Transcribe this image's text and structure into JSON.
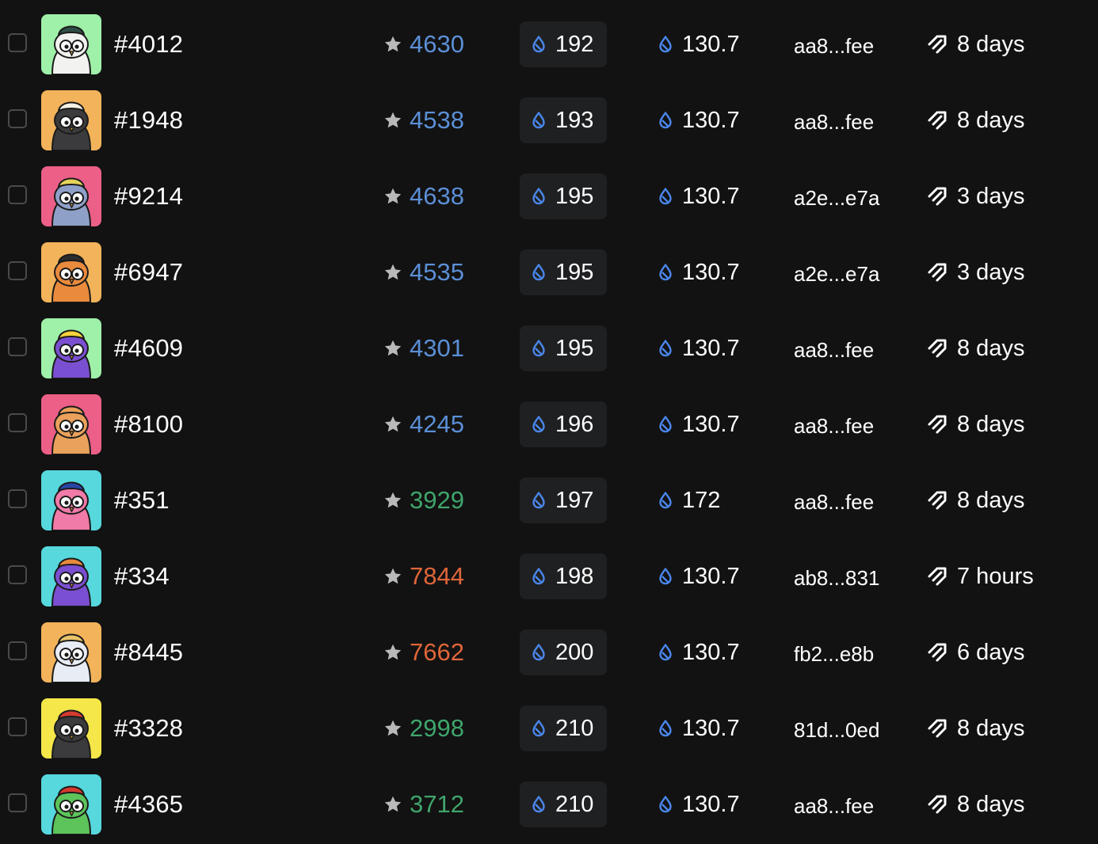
{
  "colors": {
    "background": "#121212",
    "pill": "#1f2022",
    "rank_blue": "#5b8fd6",
    "rank_green": "#3fa56c",
    "rank_orange": "#e0663a",
    "drop_icon": "#4a86ea",
    "star": "#b9b9b9"
  },
  "icons": {
    "rank": "star-icon",
    "price": "water-drop-icon",
    "last_sale": "water-drop-icon",
    "listed": "lightning-stripes-icon",
    "select": "checkbox"
  },
  "rows": [
    {
      "id": "#4012",
      "rank": "4630",
      "rank_color": "#5b8fd6",
      "price": "192",
      "last_sale": "130.7",
      "owner": "aa8...fee",
      "listed": "8 days",
      "avatar": {
        "bg": "#9ff0a8",
        "body": "#f2f2f0",
        "hat": "#2f4f46"
      }
    },
    {
      "id": "#1948",
      "rank": "4538",
      "rank_color": "#5b8fd6",
      "price": "193",
      "last_sale": "130.7",
      "owner": "aa8...fee",
      "listed": "8 days",
      "avatar": {
        "bg": "#f2b35a",
        "body": "#3b3b3d",
        "hat": "#f5f0e4"
      }
    },
    {
      "id": "#9214",
      "rank": "4638",
      "rank_color": "#5b8fd6",
      "price": "195",
      "last_sale": "130.7",
      "owner": "a2e...e7a",
      "listed": "3 days",
      "avatar": {
        "bg": "#ec5f86",
        "body": "#8fa0c8",
        "hat": "#e6d35a"
      }
    },
    {
      "id": "#6947",
      "rank": "4535",
      "rank_color": "#5b8fd6",
      "price": "195",
      "last_sale": "130.7",
      "owner": "a2e...e7a",
      "listed": "3 days",
      "avatar": {
        "bg": "#f2b35a",
        "body": "#e98a3d",
        "hat": "#2c2c2c"
      }
    },
    {
      "id": "#4609",
      "rank": "4301",
      "rank_color": "#5b8fd6",
      "price": "195",
      "last_sale": "130.7",
      "owner": "aa8...fee",
      "listed": "8 days",
      "avatar": {
        "bg": "#9ff0a8",
        "body": "#7b4fd1",
        "hat": "#f5d33b"
      }
    },
    {
      "id": "#8100",
      "rank": "4245",
      "rank_color": "#5b8fd6",
      "price": "196",
      "last_sale": "130.7",
      "owner": "aa8...fee",
      "listed": "8 days",
      "avatar": {
        "bg": "#ec5f86",
        "body": "#e9a15b",
        "hat": "#e9a15b"
      }
    },
    {
      "id": "#351",
      "rank": "3929",
      "rank_color": "#3fa56c",
      "price": "197",
      "last_sale": "172",
      "owner": "aa8...fee",
      "listed": "8 days",
      "avatar": {
        "bg": "#56d8dd",
        "body": "#f07aa8",
        "hat": "#2846a8"
      }
    },
    {
      "id": "#334",
      "rank": "7844",
      "rank_color": "#e0663a",
      "price": "198",
      "last_sale": "130.7",
      "owner": "ab8...831",
      "listed": "7 hours",
      "avatar": {
        "bg": "#56d8dd",
        "body": "#7b4fd1",
        "hat": "#e98a3d"
      }
    },
    {
      "id": "#8445",
      "rank": "7662",
      "rank_color": "#e0663a",
      "price": "200",
      "last_sale": "130.7",
      "owner": "fb2...e8b",
      "listed": "6 days",
      "avatar": {
        "bg": "#f2b35a",
        "body": "#e8ecf4",
        "hat": "#e9c46a"
      }
    },
    {
      "id": "#3328",
      "rank": "2998",
      "rank_color": "#3fa56c",
      "price": "210",
      "last_sale": "130.7",
      "owner": "81d...0ed",
      "listed": "8 days",
      "avatar": {
        "bg": "#f5e64a",
        "body": "#3b3b3d",
        "hat": "#d63b2f"
      }
    },
    {
      "id": "#4365",
      "rank": "3712",
      "rank_color": "#3fa56c",
      "price": "210",
      "last_sale": "130.7",
      "owner": "aa8...fee",
      "listed": "8 days",
      "avatar": {
        "bg": "#56d8dd",
        "body": "#5cc45a",
        "hat": "#d63b2f"
      }
    }
  ]
}
